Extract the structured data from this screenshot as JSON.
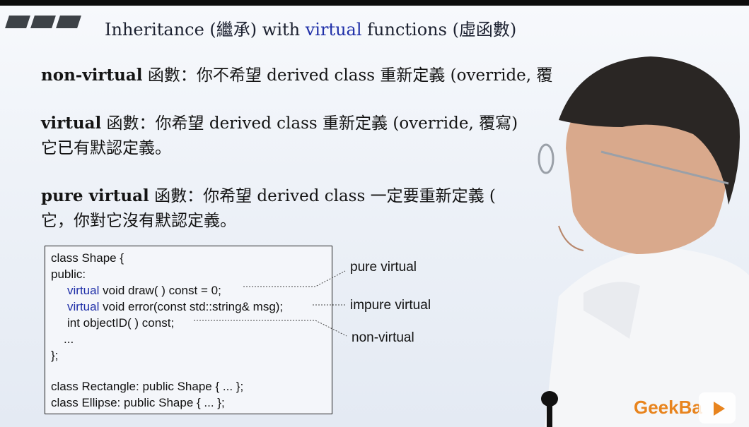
{
  "slide": {
    "title_pre": "Inheritance (繼承) with ",
    "title_kw": "virtual",
    "title_post": " functions (虛函數)",
    "line1_bold": "non-virtual",
    "line1_text": " 函數：你不希望 derived class 重新定義 (override, 覆",
    "line2_bold": "virtual",
    "line2_text": " 函數：你希望 derived class 重新定義 (override, 覆寫)",
    "line3_text": "它已有默認定義。",
    "line4_bold": "pure virtual",
    "line4_text": " 函數：你希望 derived class 一定要重新定義 (",
    "line5_text": "它，你對它沒有默認定義。"
  },
  "code": {
    "line1": "class Shape {",
    "line2": "public:",
    "line3_kw": "virtual",
    "line3_rest": " void draw( ) const = 0;",
    "line4_kw": "virtual",
    "line4_rest": " void error(const std::string& msg);",
    "line5": "int objectID( ) const;",
    "line6": "...",
    "line7": "};",
    "line8": "class Rectangle: public Shape { ... };",
    "line9": "class Ellipse: public Shape { ... };"
  },
  "labels": {
    "pure": "pure virtual",
    "impure": "impure virtual",
    "nonvirtual": "non-virtual"
  },
  "brand": {
    "text": "GeekBa"
  },
  "colors": {
    "keyword": "#1f2fa8",
    "brand": "#e8841e"
  }
}
